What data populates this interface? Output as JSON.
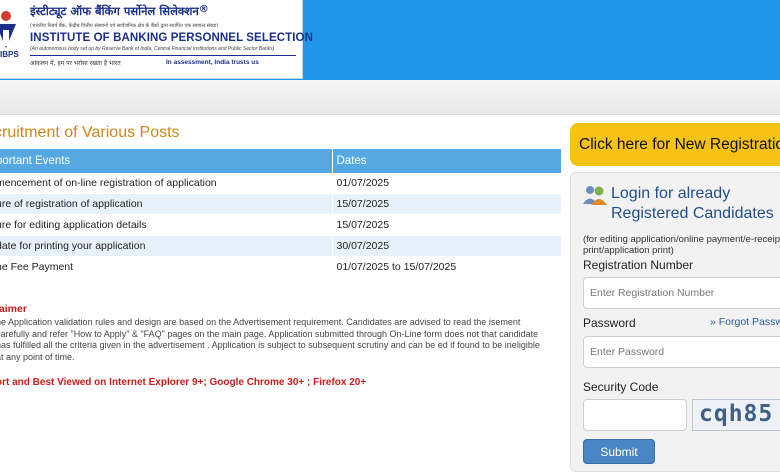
{
  "header": {
    "org_name_hindi": "इंस्टीट्यूट ऑफ बैंकिंग पर्सोनेल सिलेक्शन",
    "registered_mark": "®",
    "org_name_hindi_sub": "(भारतीय रिज़र्व बैंक, केंद्रीय वित्तीय संस्थानों एवं सार्वजनिक क्षेत्र के बैंकों द्वारा स्थापित एक स्वायत्त संस्था)",
    "org_name": "INSTITUTE OF BANKING PERSONNEL SELECTION",
    "org_name_sub": "(An autonomous body set up by Reserve Bank of India, Central Financial Institutions and Public Sector Banks)",
    "logo_text": "IBPS",
    "tagline_hindi": "आंकलन में, हम पर भरोसा रखता है भारत",
    "tagline": "In assessment, India trusts us",
    "brand_color": "#2196e9"
  },
  "main": {
    "title": "cruitment of Various Posts",
    "table": {
      "headers": [
        "portant Events",
        "Dates"
      ],
      "rows": [
        [
          "mencement of on-line registration of application",
          "01/07/2025"
        ],
        [
          "ure of registration of application",
          "15/07/2025"
        ],
        [
          "ure for editing application details",
          "15/07/2025"
        ],
        [
          "date for printing your application",
          "30/07/2025"
        ],
        [
          "ne Fee Payment",
          "01/07/2025 to 15/07/2025"
        ]
      ]
    },
    "disclaimer_title": "laimer",
    "disclaimer_text": "ne Application validation rules and design are based on the Advertisement requirement. Candidates are advised to read the isement carefully and refer \"How to Apply\" & \"FAQ\" pages on the main page. Application submitted through On-Line form does not that candidate has fulfilled all the criteria given in the advertisement . Application is subject to subsequent scrutiny and can be ed if found to be ineligible at any point of time.",
    "browser_note": "ort and Best Viewed on Internet Explorer 9+; Google Chrome 30+ ; Firefox 20+"
  },
  "sidebar": {
    "new_registration": "Click here for New Registration",
    "login_title_line1": "Login for already",
    "login_title_line2": "Registered Candidates",
    "login_note": "(for editing application/online payment/e-receipt print/application print)",
    "registration_label": "Registration Number",
    "registration_placeholder": "Enter Registration Number",
    "password_label": "Password",
    "forgot_password": "» Forgot Password",
    "password_placeholder": "Enter Password",
    "security_code_label": "Security Code",
    "captcha_text": "cqh85",
    "submit_label": "Submit",
    "accent_color": "#f6c214"
  }
}
